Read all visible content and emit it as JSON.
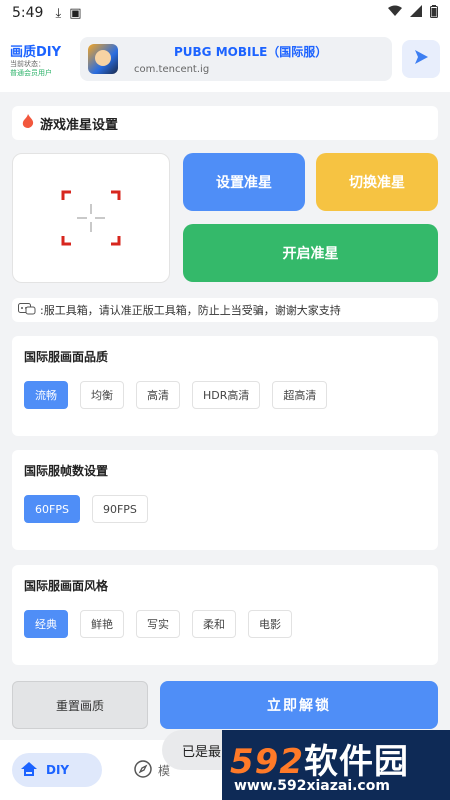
{
  "status_bar": {
    "time": "5:49"
  },
  "app": {
    "brand_title": "画质DIY",
    "status_label": "当前状态：",
    "user_type": "普通会员用户"
  },
  "game": {
    "name": "PUBG MOBILE（国际服）",
    "package": "com.tencent.ig"
  },
  "crosshair_section": {
    "title": "游戏准星设置"
  },
  "buttons": {
    "set_crosshair": "设置准星",
    "switch_crosshair": "切换准星",
    "open_crosshair": "开启准星"
  },
  "notice": {
    "text": ":服工具箱，请认准正版工具箱，防止上当受骗，谢谢大家支持"
  },
  "quality": {
    "title": "国际服画面品质",
    "options": [
      "流畅",
      "均衡",
      "高清",
      "HDR高清",
      "超高清"
    ],
    "selected": "流畅"
  },
  "fps": {
    "title": "国际服帧数设置",
    "options": [
      "60FPS",
      "90FPS"
    ],
    "selected": "60FPS"
  },
  "style": {
    "title": "国际服画面风格",
    "options": [
      "经典",
      "鲜艳",
      "写实",
      "柔和",
      "电影"
    ],
    "selected": "经典"
  },
  "actions": {
    "reset": "重置画质",
    "unlock": "立即解锁"
  },
  "tabs": {
    "diy": "DIY",
    "other_partial": "模"
  },
  "toast": {
    "text": "已是最"
  },
  "watermark": {
    "brand_num": "592",
    "brand_text": "软件园",
    "url": "www.592xiazai.com"
  },
  "colors": {
    "accent": "#4f8ef7",
    "yellow": "#f6c342",
    "green": "#34b96a",
    "brand_blue": "#1c63ff"
  }
}
